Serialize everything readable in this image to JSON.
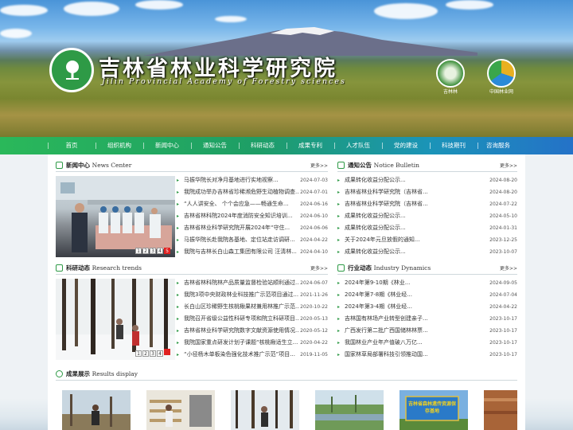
{
  "header": {
    "title": "吉林省林业科学研究院",
    "subtitle": "Jilin Provincial Academy of Forestry sciences",
    "badge_left": "吉林林",
    "badge_right": "中国林业网"
  },
  "nav": [
    "首页",
    "组织机构",
    "新闻中心",
    "通知公告",
    "科研动态",
    "成果专利",
    "人才队伍",
    "党的建设",
    "科技期刊",
    "咨询服务"
  ],
  "news": {
    "title": "新闻中心",
    "title_en": "News Center",
    "more": "更多>>",
    "slider_dots": [
      "1",
      "2",
      "3",
      "4",
      "5"
    ],
    "items": [
      {
        "text": "马振华院长对净月基地进行实地视察...",
        "date": "2024-07-03"
      },
      {
        "text": "我院成功举办吉林省珍稀濒危野生动植物调查...",
        "date": "2024-07-01"
      },
      {
        "text": "“人人讲安全、 个个会应急——畅通生命...",
        "date": "2024-06-16"
      },
      {
        "text": "吉林省林科院2024年度消防安全知识培训...",
        "date": "2024-06-10"
      },
      {
        "text": "吉林省林业科学研究院开展2024年“守住...",
        "date": "2024-06-06"
      },
      {
        "text": "马振华院长赴我院各基地、定位站走访调研...",
        "date": "2024-04-22"
      },
      {
        "text": "我院与吉林长白山森工集团有限公司 汪清林...",
        "date": "2024-04-10"
      }
    ]
  },
  "notice": {
    "title": "通知公告",
    "title_en": "Notice Bulletin",
    "more": "更多>>",
    "items": [
      {
        "text": "成果转化收益分配公示...",
        "date": "2024-08-20"
      },
      {
        "text": "吉林省林业科学研究院（吉林省...",
        "date": "2024-08-20"
      },
      {
        "text": "吉林省林业科学研究院（吉林省...",
        "date": "2024-07-22"
      },
      {
        "text": "成果转化收益分配公示...",
        "date": "2024-05-10"
      },
      {
        "text": "成果转化收益分配公示...",
        "date": "2024-01-31"
      },
      {
        "text": "关于2024年元旦放假的通知...",
        "date": "2023-12-25"
      },
      {
        "text": "成果转化收益分配公示...",
        "date": "2023-10-07"
      }
    ]
  },
  "research": {
    "title": "科研动态",
    "title_en": "Research trends",
    "more": "更多>>",
    "slider_dots": [
      "1",
      "2",
      "3",
      "4"
    ],
    "items": [
      {
        "text": "吉林省林科院林产品质量监督检验站顺利通过...",
        "date": "2024-06-07"
      },
      {
        "text": "我院3项中央财政林业科技推广示范项目通过...",
        "date": "2021-11-26"
      },
      {
        "text": "长白山区珍稀野生核桃楸果材兼用林推广示范...",
        "date": "2020-10-22"
      },
      {
        "text": "我院召开省级公益性科研专项和院立科研项目...",
        "date": "2020-05-13"
      },
      {
        "text": "吉林省林业科学研究院数字文献资源使用情况...",
        "date": "2020-05-12"
      },
      {
        "text": "我院国家重点研发计划子课题“核桃楸适生立...",
        "date": "2020-04-22"
      },
      {
        "text": "“小径杨木单板染色强化技术推广示范”项目...",
        "date": "2019-11-05"
      }
    ]
  },
  "industry": {
    "title": "行业动态",
    "title_en": "Industry Dynamics",
    "more": "更多>>",
    "items": [
      {
        "text": "2024年第9-10期《林业...",
        "date": "2024-09-05"
      },
      {
        "text": "2024年第7-8期《林业经...",
        "date": "2024-07-04"
      },
      {
        "text": "2024年第3-4期《林业经...",
        "date": "2024-04-22"
      },
      {
        "text": "吉林国有林场产业转型创建亲子...",
        "date": "2023-10-17"
      },
      {
        "text": "广西发行第二批广西国储林林票...",
        "date": "2023-10-17"
      },
      {
        "text": "我国林业产业年产值破八万亿...",
        "date": "2023-10-17"
      },
      {
        "text": "国家林草局部署科技引领推动国...",
        "date": "2023-10-17"
      }
    ]
  },
  "results": {
    "title": "成果展示",
    "title_en": "Results display",
    "signboard": "吉林省森林遗传资源保存基地"
  },
  "colors": {
    "green": "#2e9a46",
    "nav_start": "#2ab85a",
    "nav_end": "#2472c8",
    "dot_active": "#e02020"
  }
}
